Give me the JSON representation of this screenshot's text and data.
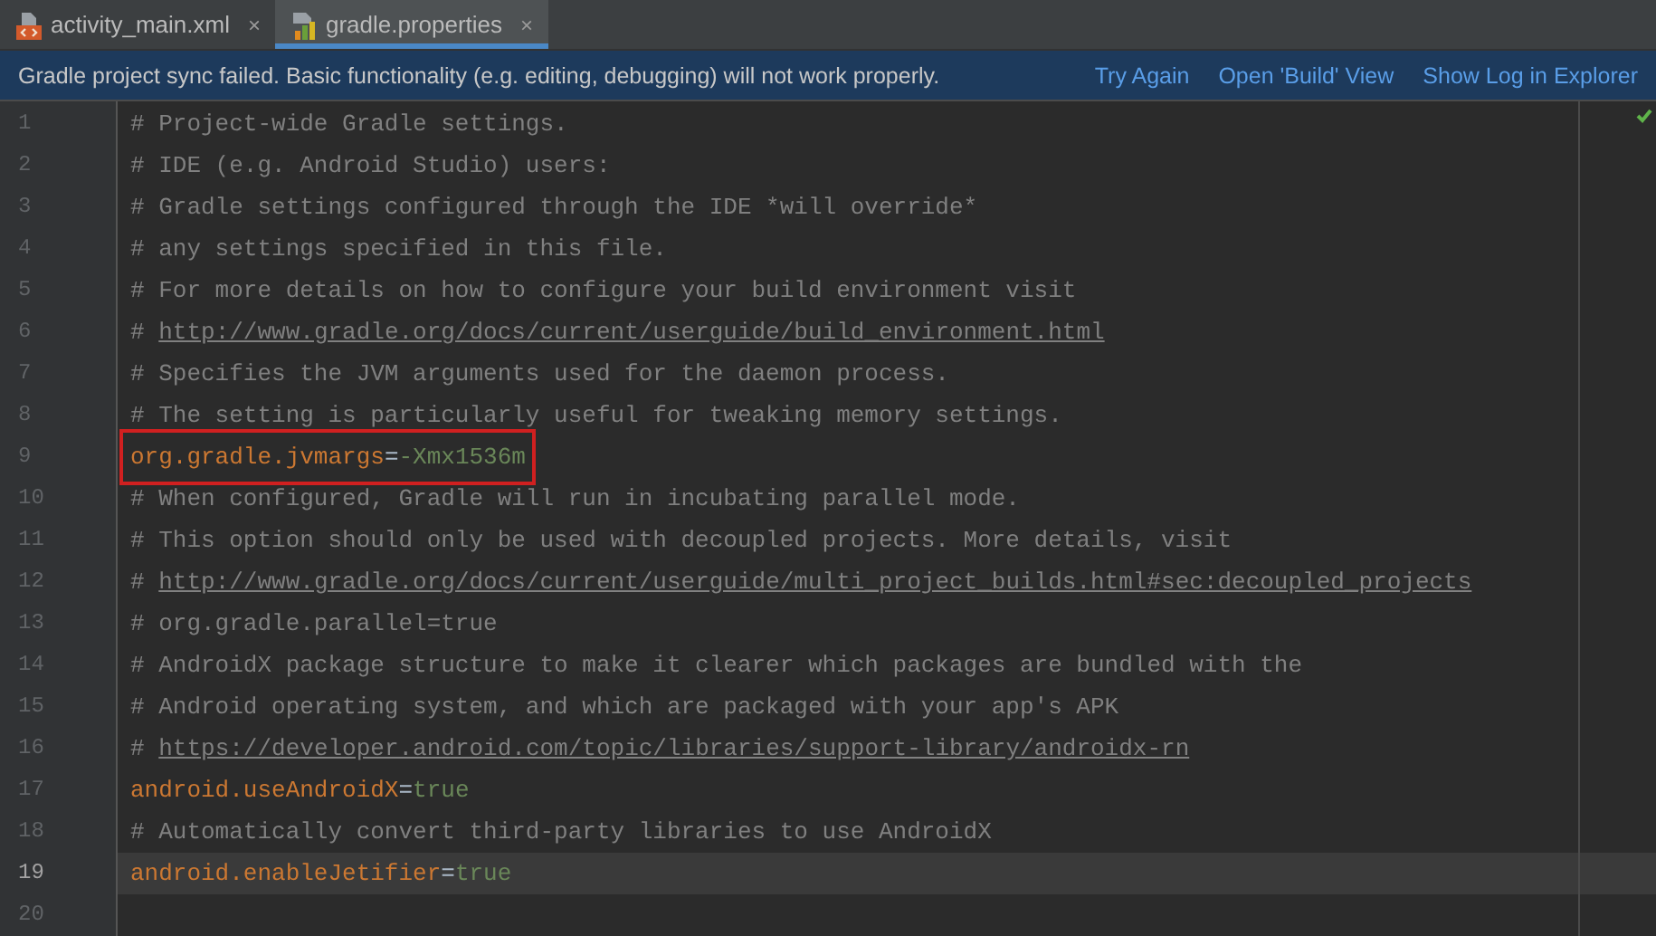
{
  "tabs": [
    {
      "label": "activity_main.xml",
      "close": "×",
      "selected": false
    },
    {
      "label": "gradle.properties",
      "close": "×",
      "selected": true
    }
  ],
  "notification": {
    "message": "Gradle project sync failed. Basic functionality (e.g. editing, debugging) will not work properly.",
    "actions": [
      "Try Again",
      "Open 'Build' View",
      "Show Log in Explorer"
    ]
  },
  "editor": {
    "lines": [
      {
        "number": "1",
        "kind": "comment",
        "text": "# Project-wide Gradle settings.",
        "current": false
      },
      {
        "number": "2",
        "kind": "comment",
        "text": "# IDE (e.g. Android Studio) users:",
        "current": false
      },
      {
        "number": "3",
        "kind": "comment",
        "text": "# Gradle settings configured through the IDE *will override*",
        "current": false
      },
      {
        "number": "4",
        "kind": "comment",
        "text": "# any settings specified in this file.",
        "current": false
      },
      {
        "number": "5",
        "kind": "comment",
        "text": "# For more details on how to configure your build environment visit",
        "current": false
      },
      {
        "number": "6",
        "kind": "link",
        "prefix": "#",
        "text": "http://www.gradle.org/docs/current/userguide/build_environment.html",
        "current": false
      },
      {
        "number": "7",
        "kind": "comment",
        "text": "# Specifies the JVM arguments used for the daemon process.",
        "current": false
      },
      {
        "number": "8",
        "kind": "comment",
        "text": "# The setting is particularly useful for tweaking memory settings.",
        "current": false
      },
      {
        "number": "9",
        "kind": "property",
        "key": "org.gradle.jvmargs",
        "operator": "=",
        "value": "-Xmx1536m",
        "boxed": true,
        "current": false
      },
      {
        "number": "10",
        "kind": "comment",
        "text": "# When configured, Gradle will run in incubating parallel mode.",
        "current": false
      },
      {
        "number": "11",
        "kind": "comment",
        "text": "# This option should only be used with decoupled projects. More details, visit",
        "current": false
      },
      {
        "number": "12",
        "kind": "link",
        "prefix": "#",
        "text": "http://www.gradle.org/docs/current/userguide/multi_project_builds.html#sec:decoupled_projects",
        "current": false
      },
      {
        "number": "13",
        "kind": "comment",
        "text": "# org.gradle.parallel=true",
        "current": false
      },
      {
        "number": "14",
        "kind": "comment",
        "text": "# AndroidX package structure to make it clearer which packages are bundled with the",
        "current": false
      },
      {
        "number": "15",
        "kind": "comment",
        "text": "# Android operating system, and which are packaged with your app's APK",
        "current": false
      },
      {
        "number": "16",
        "kind": "link",
        "prefix": "#",
        "text": "https://developer.android.com/topic/libraries/support-library/androidx-rn",
        "current": false
      },
      {
        "number": "17",
        "kind": "property",
        "key": "android.useAndroidX",
        "operator": "=",
        "value": "true",
        "boxed": false,
        "current": false
      },
      {
        "number": "18",
        "kind": "comment",
        "text": "# Automatically convert third-party libraries to use AndroidX",
        "current": false
      },
      {
        "number": "19",
        "kind": "property",
        "key": "android.enableJetifier",
        "operator": "=",
        "value": "true",
        "boxed": false,
        "current": true
      },
      {
        "number": "20",
        "kind": "empty",
        "current": false
      }
    ]
  }
}
